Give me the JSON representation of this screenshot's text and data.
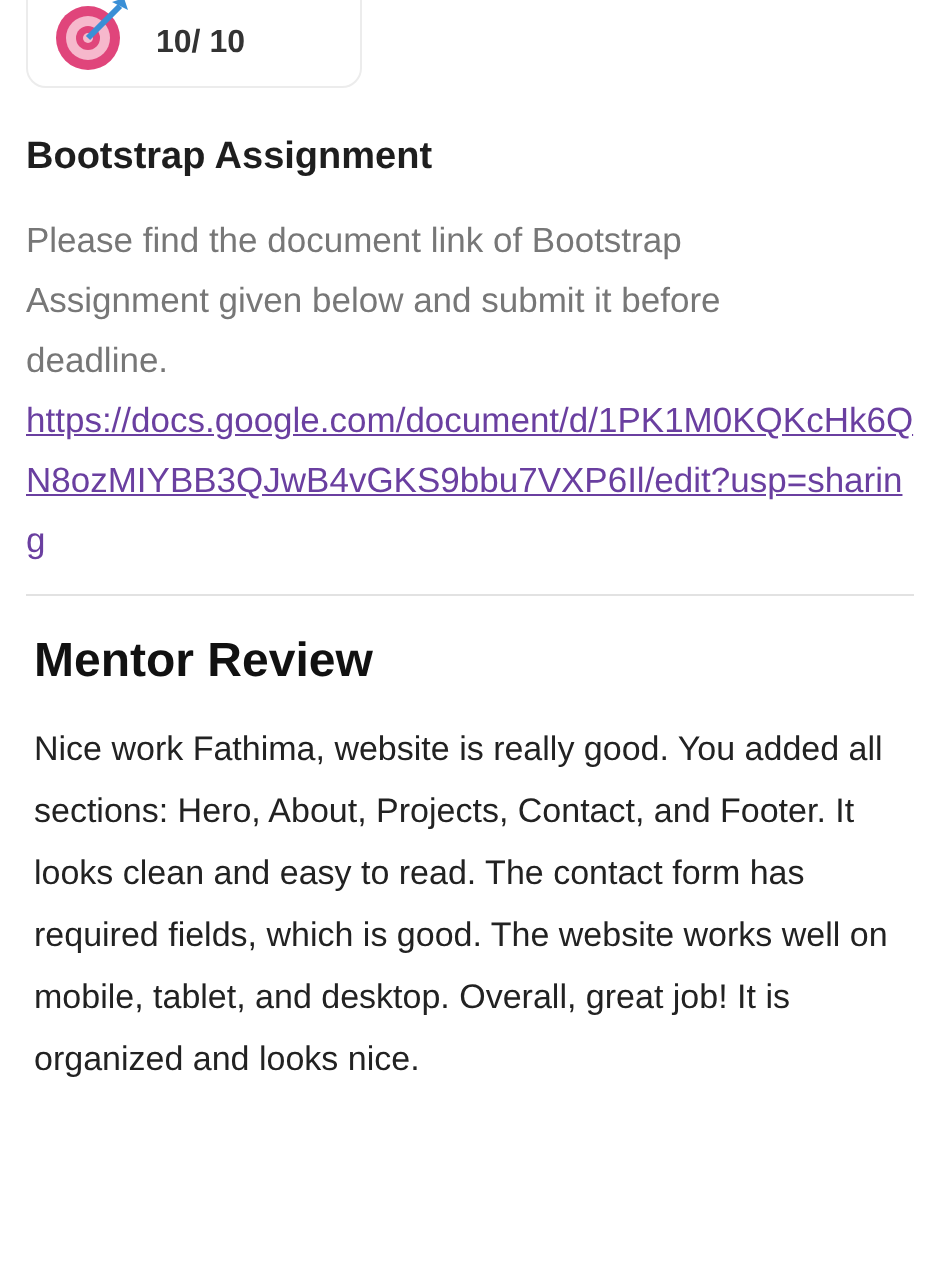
{
  "score_card": {
    "value": "10/ 10"
  },
  "assignment": {
    "title": "Bootstrap Assignment",
    "description": "Please find the document link of Bootstrap Assignment given below and submit it before deadline.",
    "link": "https://docs.google.com/document/d/1PK1M0KQKcHk6QN8ozMIYBB3QJwB4vGKS9bbu7VXP6Il/edit?usp=sharing"
  },
  "mentor_review": {
    "title": "Mentor Review",
    "text": "Nice work Fathima, website is really good. You added all sections: Hero, About, Projects, Contact, and Footer. It looks clean and easy to read. The contact form has required fields, which is good. The website works well on mobile, tablet, and desktop. Overall, great job! It is organized and looks nice."
  }
}
